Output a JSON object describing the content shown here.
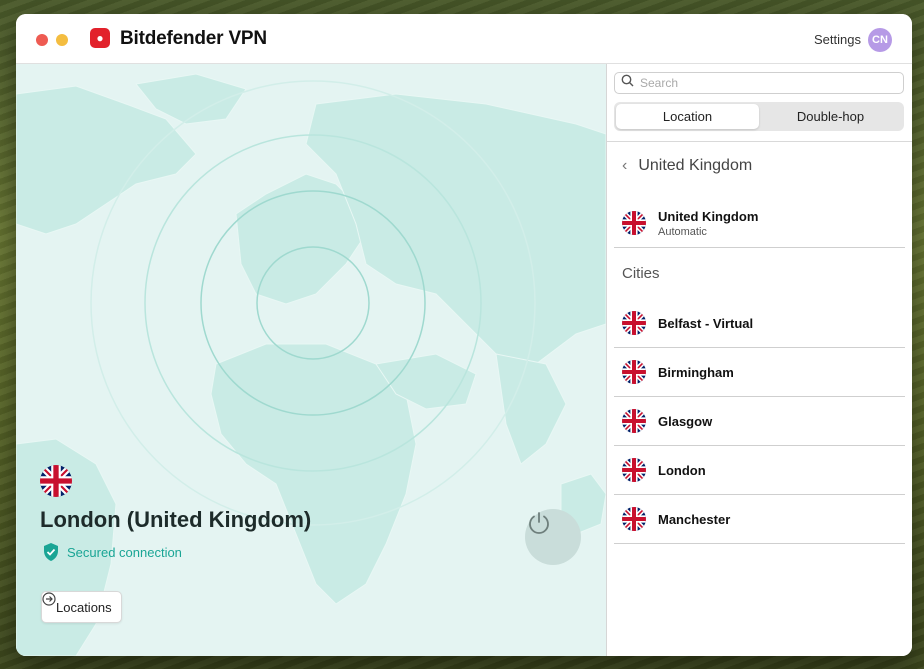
{
  "app": {
    "brand_name": "Bitdefender VPN",
    "brand_color": "#e2212b",
    "settings_label": "Settings",
    "avatar_initials": "CN",
    "avatar_color": "#b69ae6"
  },
  "map": {
    "current_location": "London (United Kingdom)",
    "status_text": "Secured connection",
    "status_color": "#1aa595",
    "locations_button_label": "Locations",
    "power_icon": "power-icon"
  },
  "panel": {
    "search_placeholder": "Search",
    "tabs": [
      {
        "label": "Location",
        "active": true
      },
      {
        "label": "Double-hop",
        "active": false
      }
    ],
    "breadcrumb": "United Kingdom",
    "country": {
      "name": "United Kingdom",
      "subtitle": "Automatic"
    },
    "cities_heading": "Cities",
    "cities": [
      "Belfast - Virtual",
      "Birmingham",
      "Glasgow",
      "London",
      "Manchester"
    ]
  }
}
